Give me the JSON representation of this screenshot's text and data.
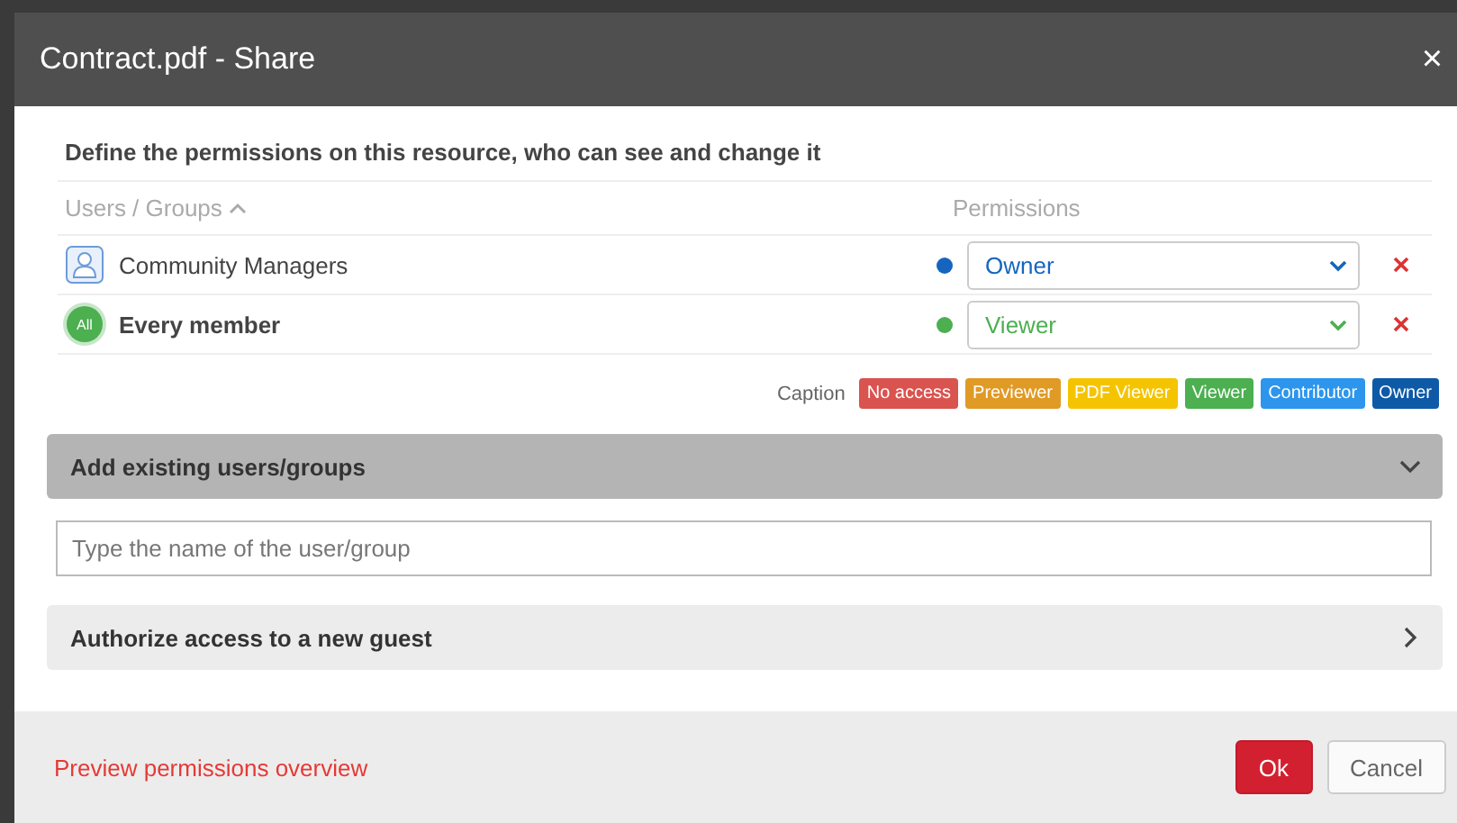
{
  "window": {
    "title": "Contract.pdf - Share",
    "close": "×"
  },
  "heading": "Define the permissions on this resource, who can see and change it",
  "table": {
    "columns": [
      {
        "label": "Users / Groups",
        "sorted": true
      },
      {
        "label": "Permissions",
        "sorted": false
      }
    ],
    "rows": [
      {
        "kind": "group",
        "name": "Community Managers",
        "bold": false,
        "permission": "Owner",
        "color": "#1565c0"
      },
      {
        "kind": "all",
        "badge": "All",
        "name": "Every member",
        "bold": true,
        "permission": "Viewer",
        "color": "#4caf50"
      }
    ]
  },
  "caption": {
    "label": "Caption",
    "items": [
      {
        "label": "No access",
        "color": "#d9534f"
      },
      {
        "label": "Previewer",
        "color": "#e09a26"
      },
      {
        "label": "PDF Viewer",
        "color": "#f5c400"
      },
      {
        "label": "Viewer",
        "color": "#4caf50"
      },
      {
        "label": "Contributor",
        "color": "#2d95ec"
      },
      {
        "label": "Owner",
        "color": "#0e5aa7"
      }
    ]
  },
  "sections": [
    {
      "title": "Add existing users/groups",
      "expanded": true,
      "field": {
        "placeholder": "Type the name of the user/group"
      }
    },
    {
      "title": "Authorize access to a new guest",
      "expanded": false
    }
  ],
  "footer": {
    "link": "Preview permissions overview",
    "buttons": [
      {
        "label": "Ok",
        "kind": "primary"
      },
      {
        "label": "Cancel",
        "kind": "secondary"
      }
    ]
  }
}
